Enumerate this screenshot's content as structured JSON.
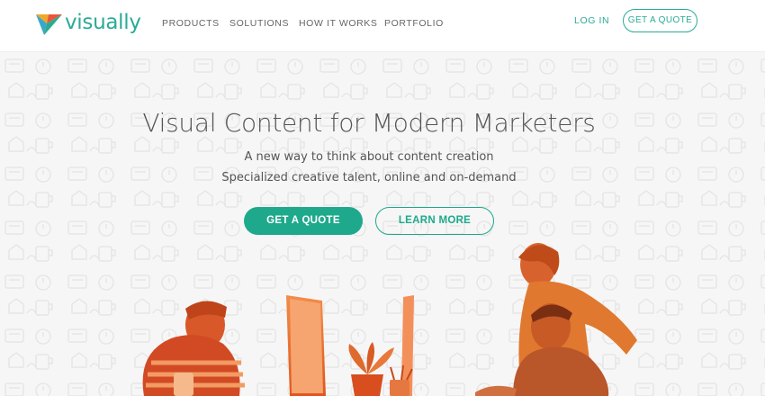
{
  "brand": {
    "name": "visually"
  },
  "nav": {
    "items": [
      {
        "label": "PRODUCTS"
      },
      {
        "label": "SOLUTIONS"
      },
      {
        "label": "HOW IT WORKS"
      },
      {
        "label": "PORTFOLIO"
      }
    ],
    "login_label": "LOG IN",
    "quote_label": "GET A QUOTE"
  },
  "hero": {
    "title": "Visual Content for Modern Marketers",
    "subtitle_1": "A new way to think about content creation",
    "subtitle_2": "Specialized creative talent, online and on-demand",
    "primary_cta": "GET A QUOTE",
    "secondary_cta": "LEARN MORE"
  },
  "colors": {
    "accent": "#1ea98c",
    "photo_tint": "#f07a2c"
  },
  "icons": [
    "logo-mark-icon",
    "doodle-pattern"
  ]
}
